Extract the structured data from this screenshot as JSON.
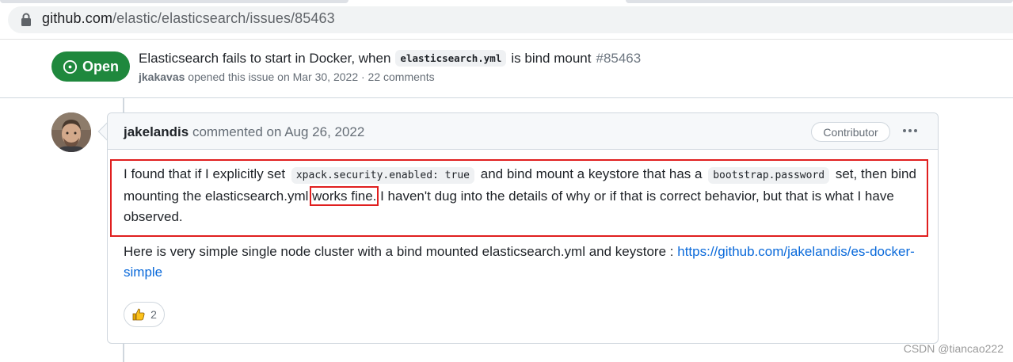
{
  "browser": {
    "url_host": "github.com",
    "url_path": "/elastic/elasticsearch/issues/85463"
  },
  "issue": {
    "state": "Open",
    "title_before": "Elasticsearch fails to start in Docker, when",
    "title_code": "elasticsearch.yml",
    "title_after": "is bind mount",
    "number": "#85463",
    "author": "jkakavas",
    "meta": "opened this issue on Mar 30, 2022 · 22 comments"
  },
  "comment": {
    "author": "jakelandis",
    "action": "commented on Aug 26, 2022",
    "role_badge": "Contributor",
    "p1_t1": "I found that if I explicitly set",
    "p1_code1": "xpack.security.enabled: true",
    "p1_t2": "and bind mount a keystore that has a",
    "p1_code2": "bootstrap.password",
    "p1_t3": "set, then bind mounting the elasticsearch.yml",
    "p1_highlight": "works fine.",
    "p1_t4": "I haven't dug into the details of why or if that is correct behavior, but that is what I have observed.",
    "p2_text": "Here is very simple single node cluster with a bind mounted elasticsearch.yml and keystore :",
    "p2_link": "https://github.com/jakelandis/es-docker-simple",
    "reaction_count": "2"
  },
  "watermark": "CSDN @tiancao222",
  "colors": {
    "open_green": "#1f883d",
    "link_blue": "#0969da",
    "highlight_red": "#e01f1f"
  },
  "icons": {
    "lock": "lock-icon",
    "state": "issue-opened-icon",
    "menu": "kebab-horizontal-icon",
    "reaction": "thumbs-up-icon"
  }
}
